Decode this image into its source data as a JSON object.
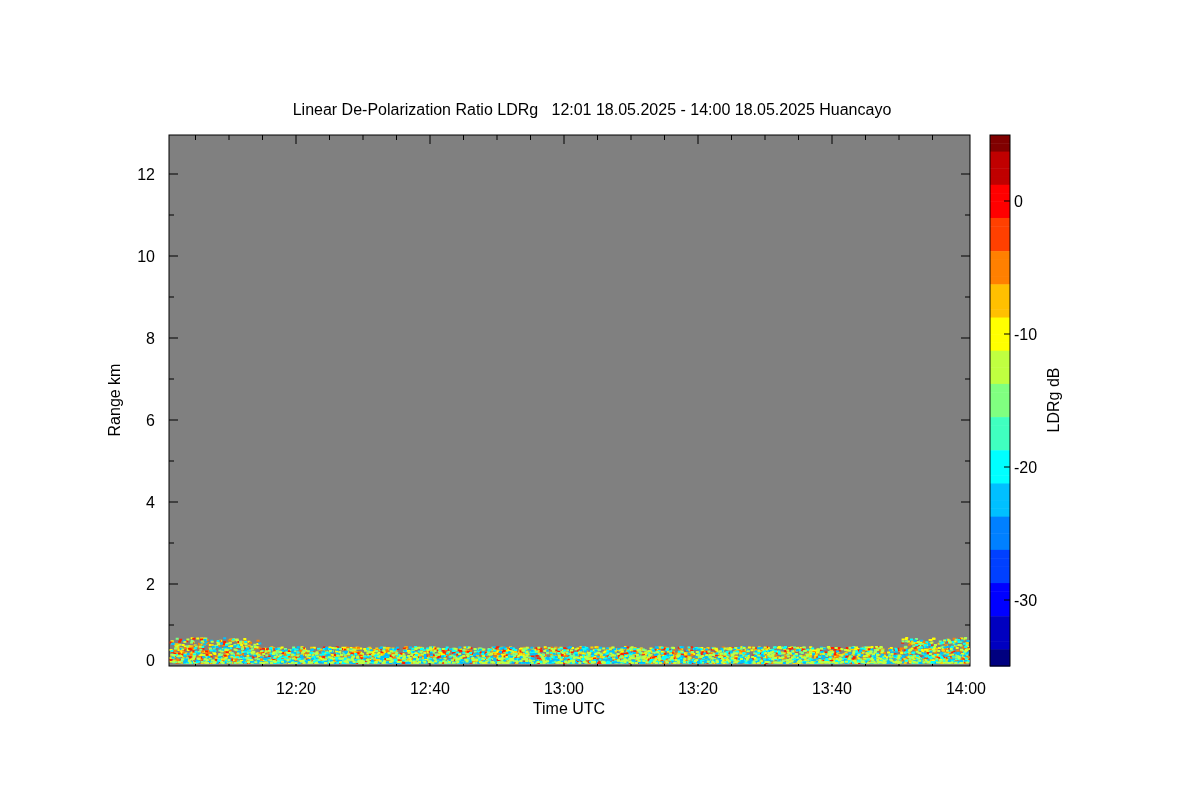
{
  "title": "Linear De-Polarization Ratio LDRg   12:01 18.05.2025 - 14:00 18.05.2025 Huancayo",
  "y_axis": {
    "label": "Range km",
    "ticks": [
      "12",
      "10",
      "8",
      "6",
      "4",
      "2",
      "0"
    ]
  },
  "x_axis": {
    "label": "Time UTC",
    "ticks": [
      "12:20",
      "12:40",
      "13:00",
      "13:20",
      "13:40",
      "14:00"
    ]
  },
  "colorbar": {
    "label": "LDRg dB",
    "ticks": [
      "0",
      "-10",
      "-20",
      "-30"
    ]
  }
}
